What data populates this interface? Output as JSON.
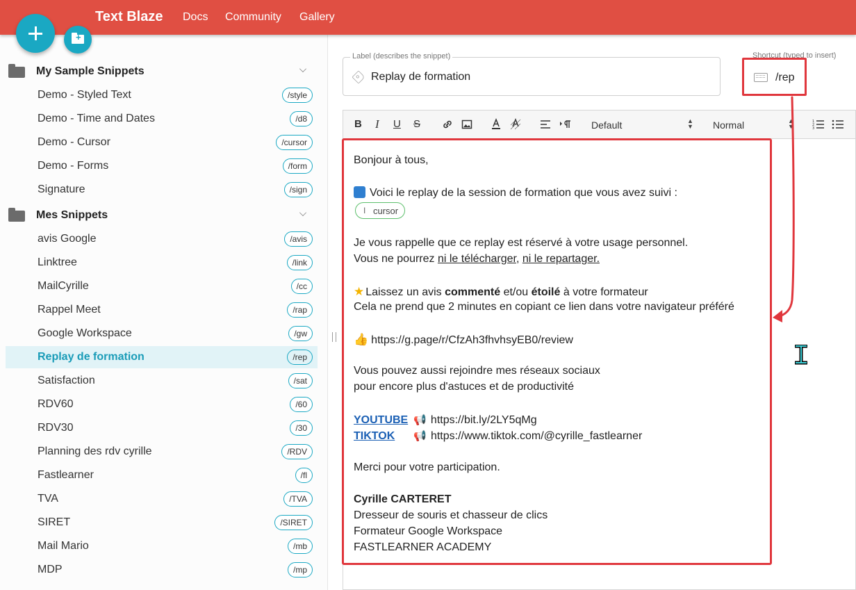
{
  "topbar": {
    "brand": "Text Blaze",
    "nav": [
      "Docs",
      "Community",
      "Gallery"
    ]
  },
  "sidebar": {
    "folders": [
      {
        "name": "My Sample Snippets",
        "items": [
          {
            "label": "Demo - Styled Text",
            "shortcut": "/style"
          },
          {
            "label": "Demo - Time and Dates",
            "shortcut": "/d8"
          },
          {
            "label": "Demo - Cursor",
            "shortcut": "/cursor"
          },
          {
            "label": "Demo - Forms",
            "shortcut": "/form"
          },
          {
            "label": "Signature",
            "shortcut": "/sign"
          }
        ]
      },
      {
        "name": "Mes Snippets",
        "items": [
          {
            "label": "avis Google",
            "shortcut": "/avis"
          },
          {
            "label": "Linktree",
            "shortcut": "/link"
          },
          {
            "label": "MailCyrille",
            "shortcut": "/cc"
          },
          {
            "label": "Rappel Meet",
            "shortcut": "/rap"
          },
          {
            "label": "Google Workspace",
            "shortcut": "/gw"
          },
          {
            "label": "Replay de formation",
            "shortcut": "/rep",
            "selected": true
          },
          {
            "label": "Satisfaction",
            "shortcut": "/sat"
          },
          {
            "label": "RDV60",
            "shortcut": "/60"
          },
          {
            "label": "RDV30",
            "shortcut": "/30"
          },
          {
            "label": "Planning des rdv cyrille",
            "shortcut": "/RDV"
          },
          {
            "label": "Fastlearner",
            "shortcut": "/fl"
          },
          {
            "label": "TVA",
            "shortcut": "/TVA"
          },
          {
            "label": "SIRET",
            "shortcut": "/SIRET"
          },
          {
            "label": "Mail Mario",
            "shortcut": "/mb"
          },
          {
            "label": "MDP",
            "shortcut": "/mp"
          }
        ]
      }
    ]
  },
  "editor": {
    "label_legend": "Label (describes the snippet)",
    "label_value": "Replay de formation",
    "shortcut_legend": "Shortcut (typed to insert)",
    "shortcut_value": "/rep",
    "toolbar": {
      "bold": "B",
      "italic": "I",
      "underline": "U",
      "strike": "S",
      "font": "Default",
      "size": "Normal"
    },
    "content": {
      "greeting": "Bonjour à tous,",
      "replay_intro": "Voici le replay de la session de formation que vous avez suivi :",
      "cursor_chip": "cursor",
      "reminder_1": "Je vous rappelle que ce replay est réservé à votre usage personnel.",
      "reminder_2_prefix": "Vous ne pourrez ",
      "reminder_2_link_1": "ni le télécharger",
      "reminder_2_sep": ", ",
      "reminder_2_link_2": "ni le repartager.",
      "review_prefix": "Laissez un avis ",
      "review_bold_1": "commenté",
      "review_mid": " et/ou ",
      "review_bold_2": "étoilé",
      "review_suffix": " à votre formateur",
      "review_line_2": "Cela ne prend que 2 minutes en copiant ce lien dans votre navigateur préféré",
      "review_url": "https://g.page/r/CfzAh3fhvhsyEB0/review",
      "social_1": "Vous pouvez aussi rejoindre mes réseaux sociaux",
      "social_2": "pour encore plus d'astuces et de productivité",
      "youtube_label": "YOUTUBE",
      "youtube_url": "https://bit.ly/2LY5qMg",
      "tiktok_label": "TIKTOK",
      "tiktok_url": "https://www.tiktok.com/@cyrille_fastlearner",
      "thanks": "Merci pour votre participation.",
      "sig_name": "Cyrille CARTERET",
      "sig_line_1": "Dresseur de souris et chasseur de clics",
      "sig_line_2": "Formateur Google Workspace",
      "sig_line_3": "FASTLEARNER ACADEMY"
    }
  },
  "colors": {
    "topbar": "#e04f43",
    "accent": "#1aa8c3",
    "highlight": "#e0373d"
  }
}
